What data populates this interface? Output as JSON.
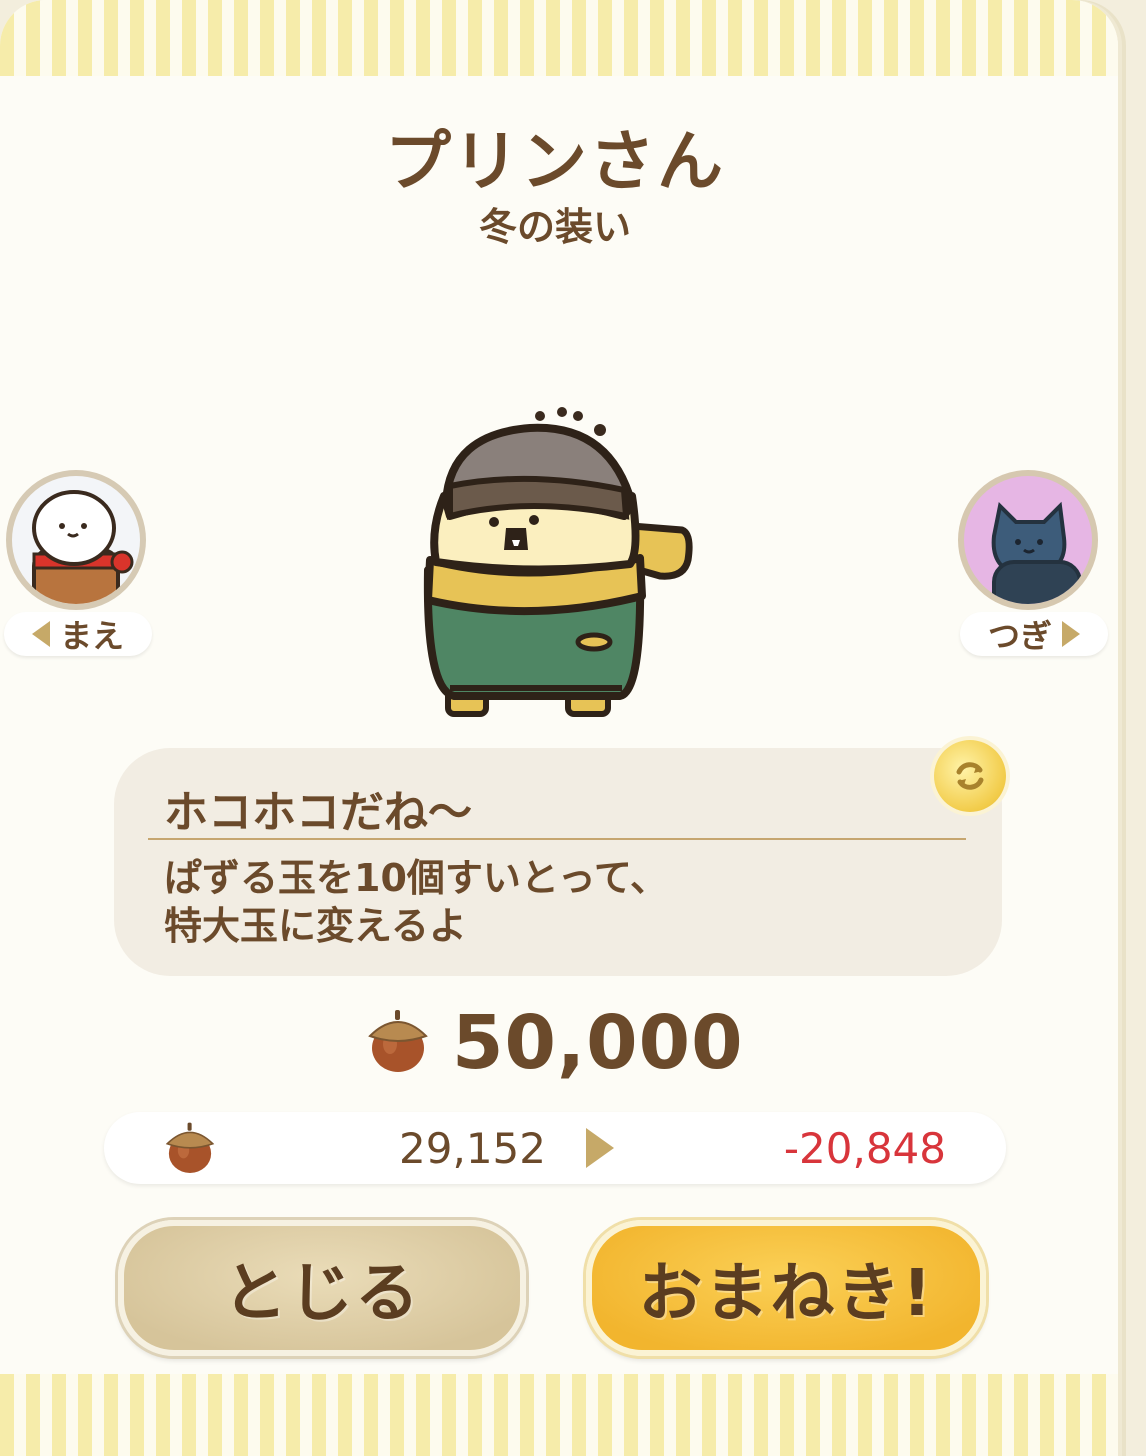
{
  "dialog": {
    "title": "プリンさん",
    "subtitle": "冬の装い"
  },
  "nav": {
    "prev_label": "まえ",
    "next_label": "つぎ"
  },
  "speech": {
    "line1": "ホコホコだね～",
    "line2_a": "ぱずる玉を10個すいとって、",
    "line2_b": "特大玉に変えるよ"
  },
  "price": {
    "currency_icon": "acorn-icon",
    "amount": "50,000"
  },
  "balance": {
    "currency_icon": "acorn-icon",
    "current": "29,152",
    "result": "-20,848"
  },
  "buttons": {
    "close_label": "とじる",
    "invite_label": "おまねき!"
  },
  "colors": {
    "text_brown": "#6b4a2b",
    "negative_red": "#d8353b",
    "accent_gold": "#f2b52e",
    "stripe_yellow": "#f6ecaa"
  }
}
